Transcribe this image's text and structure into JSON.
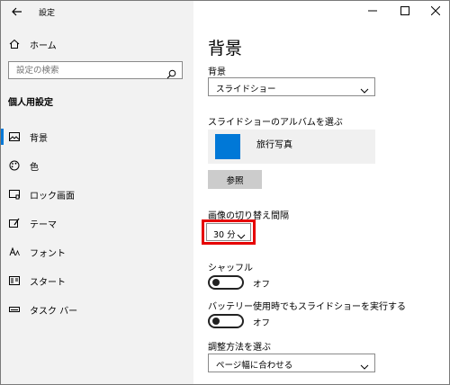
{
  "app": {
    "title": "設定"
  },
  "sidebar": {
    "home_label": "ホーム",
    "search_placeholder": "設定の検索",
    "section_title": "個人用設定",
    "items": [
      {
        "label": "背景",
        "icon": "picture-icon"
      },
      {
        "label": "色",
        "icon": "palette-icon"
      },
      {
        "label": "ロック画面",
        "icon": "lock-screen-icon"
      },
      {
        "label": "テーマ",
        "icon": "theme-icon"
      },
      {
        "label": "フォント",
        "icon": "font-icon"
      },
      {
        "label": "スタート",
        "icon": "start-icon"
      },
      {
        "label": "タスク バー",
        "icon": "taskbar-icon"
      }
    ],
    "selected": "背景"
  },
  "main": {
    "title": "背景",
    "background_label": "背景",
    "background_value": "スライドショー",
    "album_label": "スライドショーのアルバムを選ぶ",
    "album_name": "旅行写真",
    "browse_label": "参照",
    "interval_label": "画像の切り替え間隔",
    "interval_value": "30 分",
    "shuffle_label": "シャッフル",
    "shuffle_state": "オフ",
    "battery_label": "バッテリー使用時でもスライドショーを実行する",
    "battery_state": "オフ",
    "fit_label": "調整方法を選ぶ",
    "fit_value": "ページ幅に合わせる"
  },
  "colors": {
    "accent": "#0078d7",
    "sidebar_bg": "#f2f2f2",
    "highlight": "#e60000"
  }
}
